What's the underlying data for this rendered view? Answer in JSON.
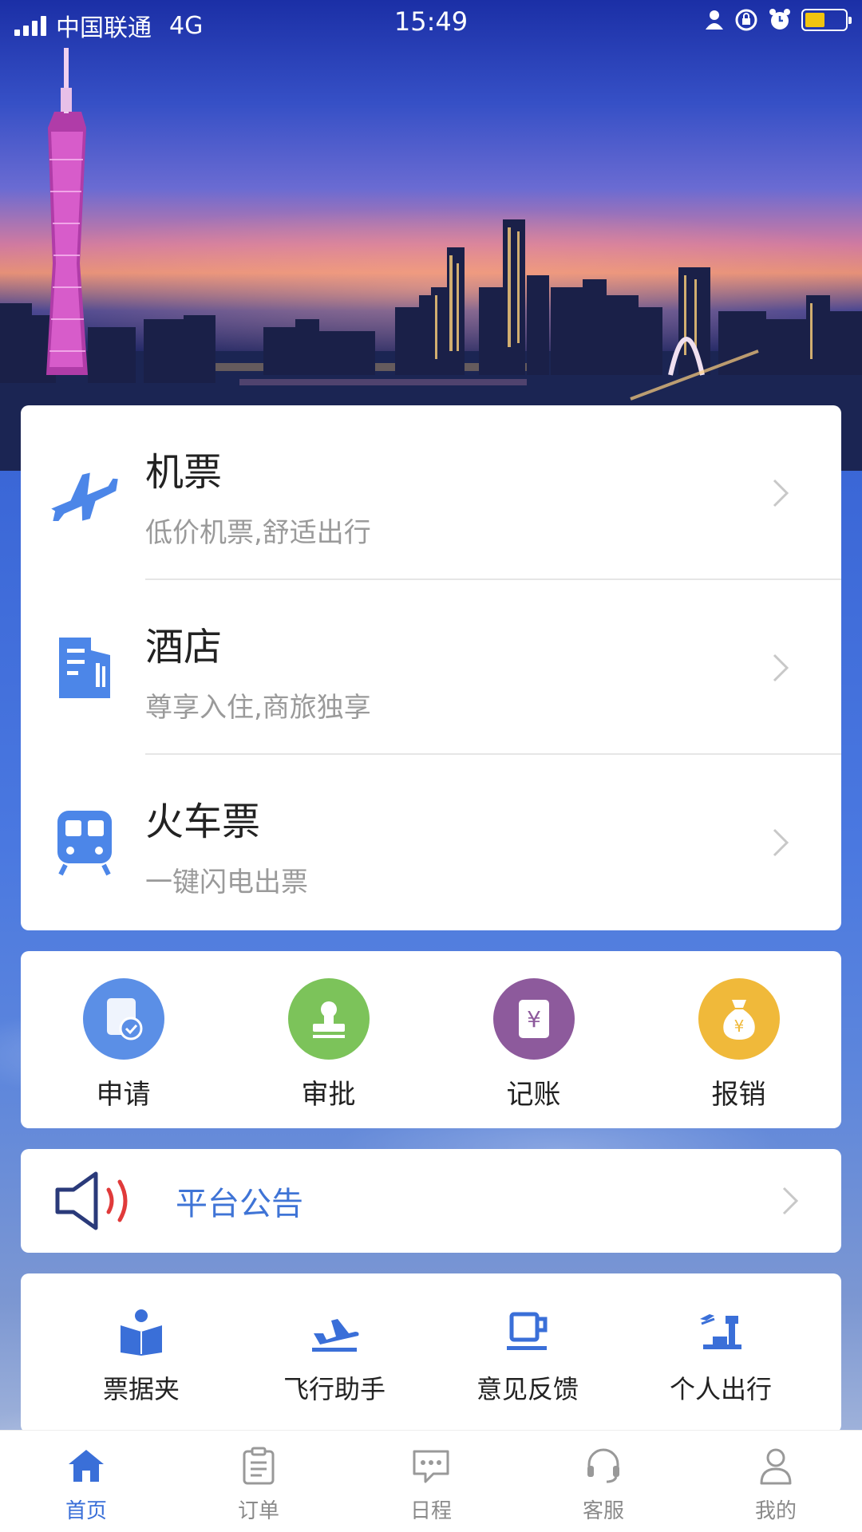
{
  "status_bar": {
    "carrier": "中国联通",
    "network": "4G",
    "time": "15:49"
  },
  "services": [
    {
      "title": "机票",
      "subtitle": "低价机票,舒适出行",
      "icon": "airplane-icon"
    },
    {
      "title": "酒店",
      "subtitle": "尊享入住,商旅独享",
      "icon": "building-icon"
    },
    {
      "title": "火车票",
      "subtitle": "一键闪电出票",
      "icon": "train-icon"
    }
  ],
  "quick_actions": [
    {
      "label": "申请",
      "icon": "document-check-icon",
      "color": "#5b8fe6"
    },
    {
      "label": "审批",
      "icon": "stamp-icon",
      "color": "#7cc35a"
    },
    {
      "label": "记账",
      "icon": "ledger-icon",
      "color": "#8d5a9c"
    },
    {
      "label": "报销",
      "icon": "money-bag-icon",
      "color": "#f0b93a"
    }
  ],
  "notice": {
    "label": "平台公告",
    "icon": "speaker-icon"
  },
  "tools": [
    {
      "label": "票据夹",
      "icon": "reader-icon"
    },
    {
      "label": "飞行助手",
      "icon": "takeoff-icon"
    },
    {
      "label": "意见反馈",
      "icon": "cup-icon"
    },
    {
      "label": "个人出行",
      "icon": "tower-icon"
    }
  ],
  "tabbar": [
    {
      "label": "首页",
      "icon": "home-icon",
      "active": true
    },
    {
      "label": "订单",
      "icon": "clipboard-icon",
      "active": false
    },
    {
      "label": "日程",
      "icon": "chat-bubble-icon",
      "active": false
    },
    {
      "label": "客服",
      "icon": "headset-icon",
      "active": false
    },
    {
      "label": "我的",
      "icon": "user-icon",
      "active": false
    }
  ],
  "colors": {
    "accent": "#3a6fd8",
    "icon_blue": "#4c86e8"
  }
}
